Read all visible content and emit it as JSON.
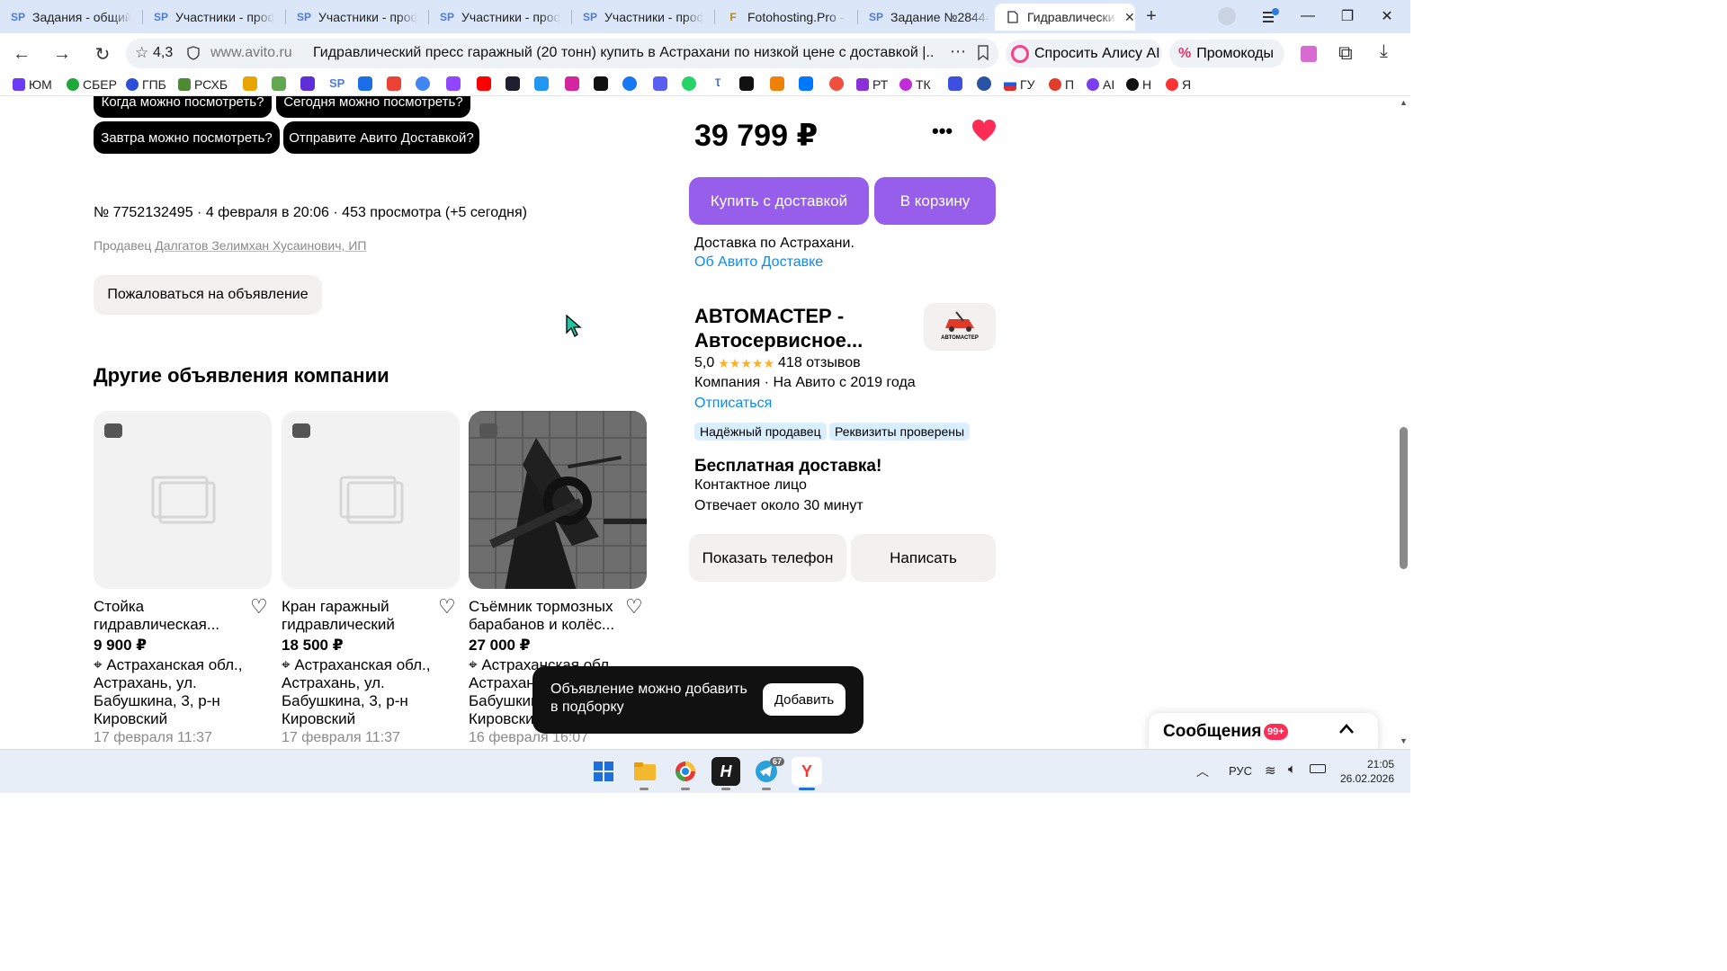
{
  "browser": {
    "tabs": [
      {
        "icon": "SP",
        "label": "Задания - общий с"
      },
      {
        "icon": "SP",
        "label": "Участники - проф"
      },
      {
        "icon": "SP",
        "label": "Участники - проф"
      },
      {
        "icon": "SP",
        "label": "Участники - проф"
      },
      {
        "icon": "SP",
        "label": "Участники - проф"
      },
      {
        "icon": "F",
        "label": "Fotohosting.Pro - С"
      },
      {
        "icon": "SP",
        "label": "Задание №28444("
      },
      {
        "icon": "doc-icon",
        "label": "Гидравлически"
      }
    ],
    "rating": "4,3",
    "domain": "www.avito.ru",
    "page_title": "Гидравлический пресс гаражный (20 тонн) купить в Астрахани по низкой цене с доставкой |...",
    "alice_label": "Спросить Алису AI",
    "promo_label": "Промокоды",
    "bookmarks": [
      "ЮМ",
      "СБЕР",
      "ГПБ",
      "РСХБ",
      "РТ",
      "ТК",
      "ГУ",
      "П",
      "AI",
      "Н",
      "Я"
    ]
  },
  "questions": {
    "q1": "Когда можно посмотреть?",
    "q2": "Сегодня можно посмотреть?",
    "q3": "Завтра можно посмотреть?",
    "q4": "Отправите Авито Доставкой?"
  },
  "listing": {
    "meta": "№ 7752132495 · 4 февраля в 20:06 · 453 просмотра (+5 сегодня)",
    "seller_prefix": "Продавец",
    "seller_name": "Далгатов Зелимхан Хусаинович, ИП",
    "report_label": "Пожаловаться на объявление",
    "other_title": "Другие объявления компании"
  },
  "cards": [
    {
      "title": "Стойка гидравлическая...",
      "price": "9 900 ₽",
      "address": "Астраханская обл., Астрахань, ул. Бабушкина, 3, р-н Кировский",
      "date": "17 февраля 11:37"
    },
    {
      "title": "Кран гаражный гидравлический",
      "price": "18 500 ₽",
      "address": "Астраханская обл., Астрахань, ул. Бабушкина, 3, р-н Кировский",
      "date": "17 февраля 11:37"
    },
    {
      "title": "Съёмник тормозных барабанов и колёс...",
      "price": "27 000 ₽",
      "address": "Астраханская обл., Астрахань, ул. Бабушкина, 3, р-н Кировский",
      "date": "16 февраля 16:07"
    }
  ],
  "sidebar": {
    "price": "39 799 ₽",
    "buy_label": "Купить с доставкой",
    "cart_label": "В корзину",
    "delivery": "Доставка по Астрахани.",
    "delivery_link": "Об Авито Доставке",
    "company_name": "АВТОМАСТЕР - Автосервисное...",
    "company_logo_text": "АВТОМАСТЕР",
    "rating": "5,0",
    "stars": 5,
    "reviews": "418 отзывов",
    "company_info": "Компания · На Авито с 2019 года",
    "unsubscribe": "Отписаться",
    "badge1": "Надёжный продавец",
    "badge2": "Реквизиты проверены",
    "free_delivery": "Бесплатная доставка!",
    "contact": "Контактное лицо",
    "response": "Отвечает около 30 минут",
    "phone_label": "Показать телефон",
    "write_label": "Написать"
  },
  "toast": {
    "text": "Объявление можно добавить в подборку",
    "button": "Добавить"
  },
  "messages": {
    "label": "Сообщения",
    "count": "99+"
  },
  "taskbar": {
    "telegram_count": "67",
    "lang": "РУС",
    "time": "21:05",
    "date": "26.02.2026"
  },
  "colors": {
    "accent_purple": "#965eeb",
    "link_blue": "#0a8cf0",
    "heart_red": "#ff2d55",
    "badge_blue": "#d9efff"
  }
}
